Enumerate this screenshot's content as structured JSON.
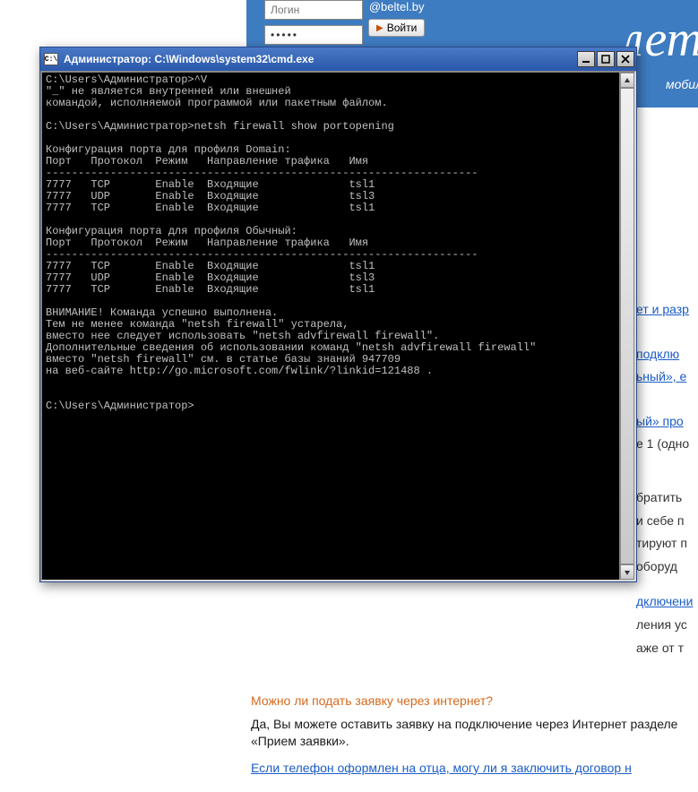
{
  "bg": {
    "login_placeholder": "Логин",
    "password_value": "•••••",
    "domain_suffix": "@beltel.by",
    "enter_label": "Войти",
    "big_fragment": "лет",
    "sub_fragment": "мобил",
    "links": {
      "l1": "ет и разр",
      "l2": "подклю",
      "l3": "ьный», е",
      "l4": "ый» про",
      "l5": "е 1 (одно",
      "l6": "братить",
      "l7": "и себе п",
      "l8": "тируют п",
      "l9": "оборуд",
      "l10": "дключени",
      "l11": "ления ус",
      "l12": "аже от т"
    },
    "faq_q1": "Можно ли подать заявку через интернет?",
    "faq_a1": "Да, Вы можете оставить заявку на подключение через Интернет разделе «Прием заявки».",
    "faq_q2": "Если телефон оформлен на отца, могу ли я заключить договор н"
  },
  "cmd": {
    "icon_label": "C:\\",
    "title": "Администратор: C:\\Windows\\system32\\cmd.exe",
    "lines": [
      "C:\\Users\\Администратор>^V",
      "\"_\" не является внутренней или внешней",
      "командой, исполняемой программой или пакетным файлом.",
      "",
      "C:\\Users\\Администратор>netsh firewall show portopening",
      "",
      "Конфигурация порта для профиля Domain:",
      "Порт   Протокол  Режим   Направление трафика   Имя",
      "-------------------------------------------------------------------",
      "7777   TCP       Enable  Входящие              tsl1",
      "7777   UDP       Enable  Входящие              tsl3",
      "7777   TCP       Enable  Входящие              tsl1",
      "",
      "Конфигурация порта для профиля Обычный:",
      "Порт   Протокол  Режим   Направление трафика   Имя",
      "-------------------------------------------------------------------",
      "7777   TCP       Enable  Входящие              tsl1",
      "7777   UDP       Enable  Входящие              tsl3",
      "7777   TCP       Enable  Входящие              tsl1",
      "",
      "ВНИМАНИЕ! Команда успешно выполнена.",
      "Тем не менее команда \"netsh firewall\" устарела,",
      "вместо нее следует использовать \"netsh advfirewall firewall\".",
      "Дополнительные сведения об использовании команд \"netsh advfirewall firewall\"",
      "вместо \"netsh firewall\" см. в статье базы знаний 947709",
      "на веб-сайте http://go.microsoft.com/fwlink/?linkid=121488 .",
      "",
      "",
      "C:\\Users\\Администратор>"
    ]
  }
}
